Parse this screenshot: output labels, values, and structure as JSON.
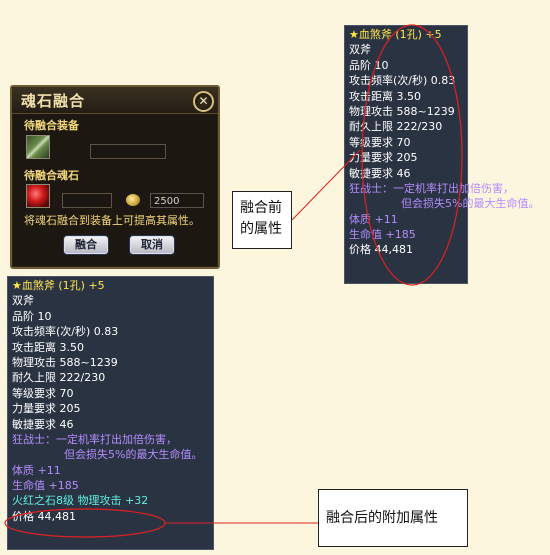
{
  "dialog": {
    "title": "魂石融合",
    "close_glyph": "✕",
    "equip_label": "待融合装备",
    "stone_label": "待融合魂石",
    "price_value": "2500",
    "tip": "将魂石融合到装备上可提高其属性。",
    "fuse_button": "融合",
    "cancel_button": "取消"
  },
  "tooltip_before": {
    "name": "★血煞斧 (1孔) +5",
    "lines": [
      "双斧",
      "品阶 10",
      "攻击频率(次/秒) 0.83",
      "攻击距离 3.50",
      "物理攻击 588~1239",
      "耐久上限 222/230",
      "等级要求 70",
      "力量要求 205",
      "敏捷要求 46"
    ],
    "skill_line1": "狂战士：一定机率打出加倍伤害，",
    "skill_line2": "但会损失5%的最大生命值。",
    "bonus1": "体质 +11",
    "bonus2": "生命值 +185",
    "price": "价格 44,481"
  },
  "tooltip_after": {
    "name": "★血煞斧 (1孔) +5",
    "lines": [
      "双斧",
      "品阶 10",
      "攻击频率(次/秒) 0.83",
      "攻击距离 3.50",
      "物理攻击 588~1239",
      "耐久上限 222/230",
      "等级要求 70",
      "力量要求 205",
      "敏捷要求 46"
    ],
    "skill_line1": "狂战士：一定机率打出加倍伤害，",
    "skill_line2": "但会损失5%的最大生命值。",
    "bonus1": "体质 +11",
    "bonus2": "生命值 +185",
    "gem_line": "火红之石8级 物理攻击 +32",
    "price": "价格 44,481"
  },
  "callouts": {
    "before_line1": "融合前",
    "before_line2": "的属性",
    "after": "融合后的附加属性"
  },
  "colors": {
    "page_bg": "#fdf6de",
    "tooltip_bg": "#2a3342",
    "item_name": "#ffe64d",
    "skill_text": "#b48cff",
    "gem_text": "#5ff0e0",
    "annotation_red": "#e02020"
  }
}
